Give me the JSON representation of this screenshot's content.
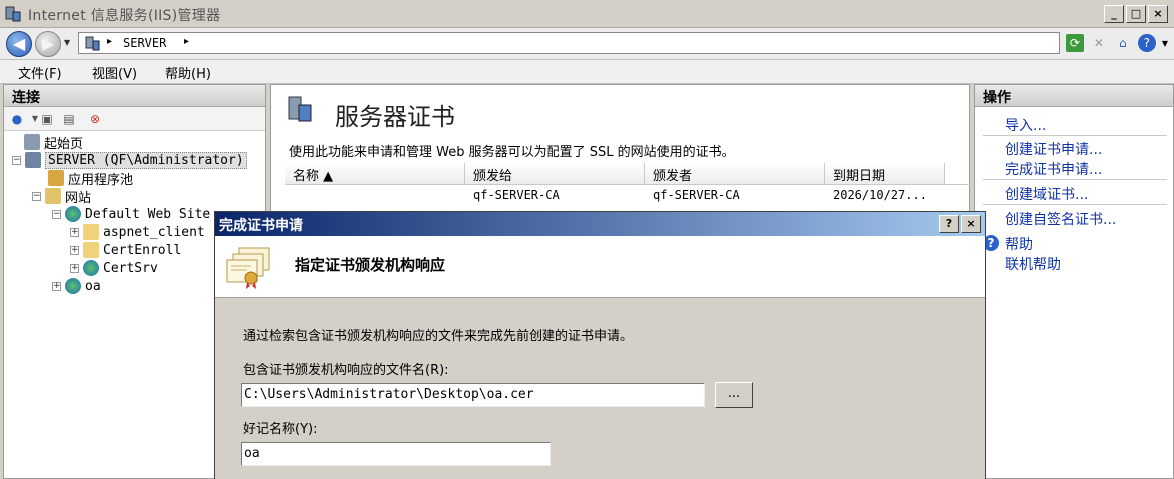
{
  "window": {
    "title": "Internet 信息服务(IIS)管理器",
    "min_label": "_",
    "max_label": "□",
    "close_label": "×"
  },
  "address": {
    "crumb": "SERVER",
    "sep": "▸"
  },
  "menu": [
    "文件(F)",
    "视图(V)",
    "帮助(H)"
  ],
  "connections": {
    "header": "连接",
    "tree": {
      "start_page": "起始页",
      "server": "SERVER (QF\\Administrator)",
      "app_pools": "应用程序池",
      "sites": "网站",
      "default_site": "Default Web Site",
      "aspnet_client": "aspnet_client",
      "certenroll": "CertEnroll",
      "certsrv": "CertSrv",
      "oa": "oa"
    }
  },
  "feature": {
    "title": "服务器证书",
    "description": "使用此功能来申请和管理 Web 服务器可以为配置了 SSL 的网站使用的证书。",
    "columns": [
      "名称 ▲",
      "颁发给",
      "颁发者",
      "到期日期"
    ],
    "rows": [
      {
        "name": "",
        "issued_to": "qf-SERVER-CA",
        "issued_by": "qf-SERVER-CA",
        "expires": "2026/10/27..."
      }
    ]
  },
  "actions": {
    "header": "操作",
    "import": "导入...",
    "create_request": "创建证书申请...",
    "complete_request": "完成证书申请...",
    "create_domain": "创建域证书...",
    "create_selfsigned": "创建自签名证书...",
    "help": "帮助",
    "online_help": "联机帮助"
  },
  "dialog": {
    "title": "完成证书申请",
    "help_btn": "?",
    "close_btn": "×",
    "heading": "指定证书颁发机构响应",
    "instruction": "通过检索包含证书颁发机构响应的文件来完成先前创建的证书申请。",
    "file_label": "包含证书颁发机构响应的文件名(R):",
    "file_value": "C:\\Users\\Administrator\\Desktop\\oa.cer",
    "browse_label": "...",
    "name_label": "好记名称(Y):",
    "name_value": "oa"
  },
  "colors": {
    "link": "#1033aa",
    "dialog_title_start": "#0a246a",
    "dialog_title_end": "#a6caf0"
  }
}
